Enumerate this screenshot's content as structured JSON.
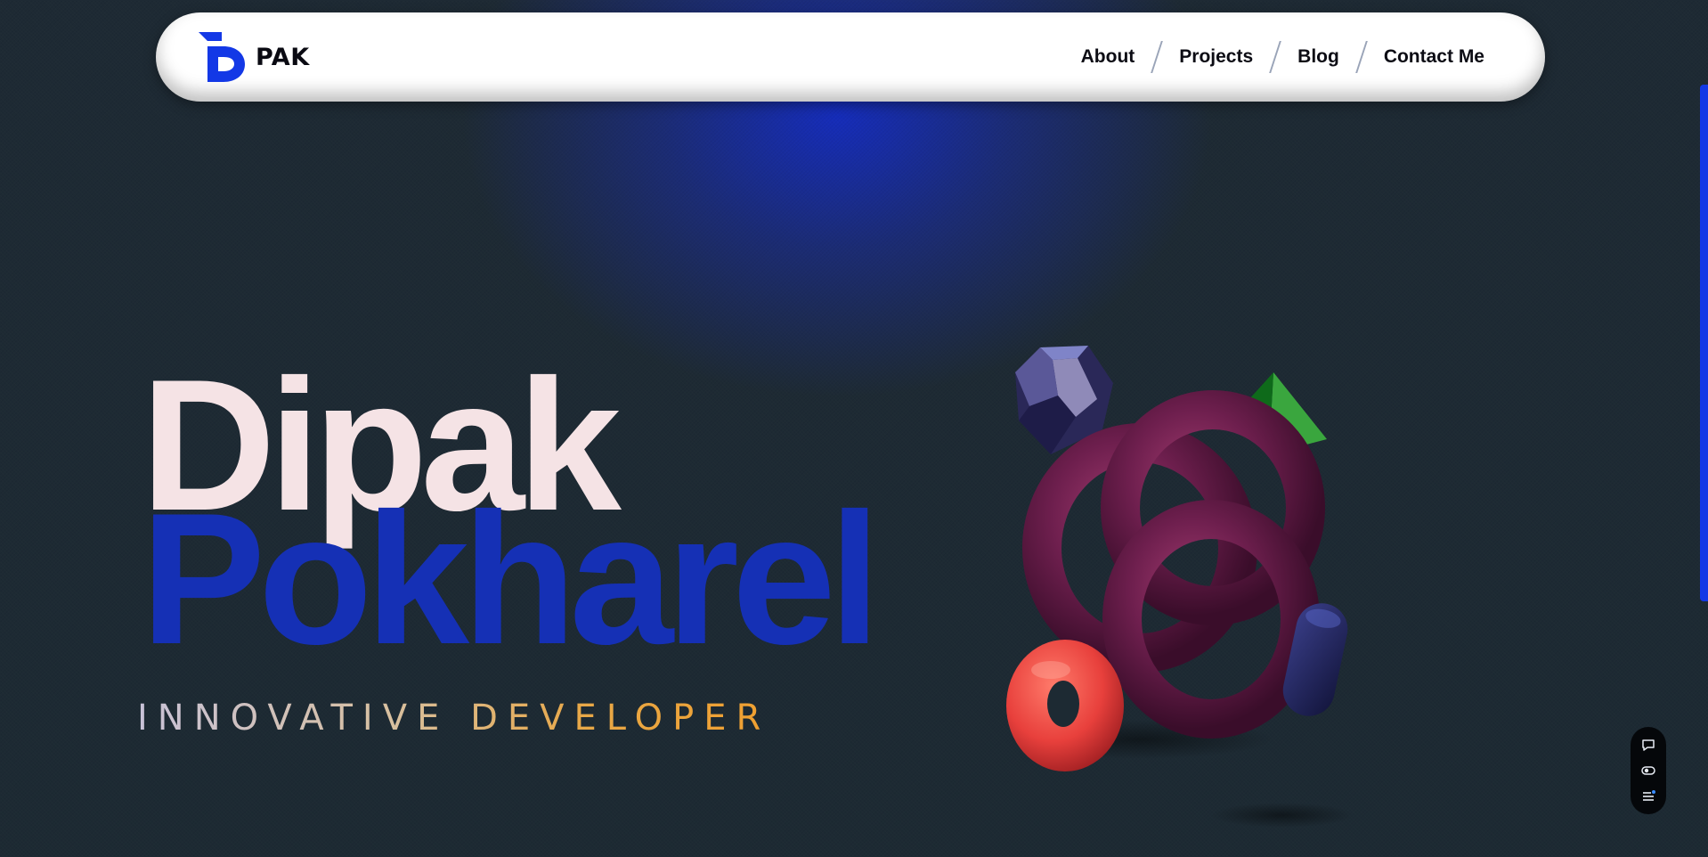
{
  "brand": {
    "logo_text": "PAK",
    "accent_color": "#1338e6"
  },
  "nav": {
    "items": [
      {
        "label": "About"
      },
      {
        "label": "Projects"
      },
      {
        "label": "Blog"
      },
      {
        "label": "Contact Me"
      }
    ]
  },
  "hero": {
    "first_name": "Dipak",
    "last_name": "Pokharel",
    "tagline": "INNOVATIVE DEVELOPER",
    "first_name_color": "#f5e3e5",
    "last_name_color": "#1530b5"
  },
  "art": {
    "shapes": [
      "dodecahedron",
      "pyramid",
      "trefoil-knot",
      "torus",
      "capsule"
    ]
  },
  "mini_toolbar": {
    "icons": [
      "chat-icon",
      "toggle-icon",
      "menu-icon"
    ]
  }
}
